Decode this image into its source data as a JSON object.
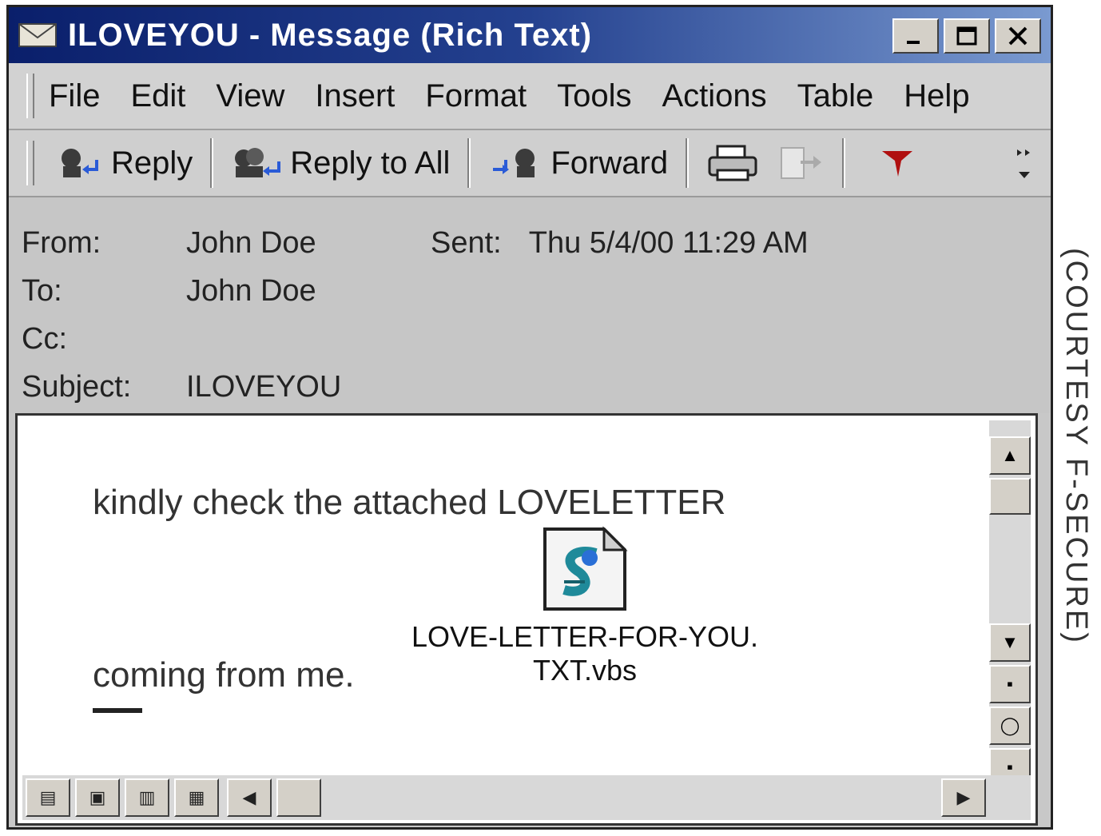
{
  "window": {
    "title": "ILOVEYOU - Message (Rich Text)",
    "title_bar_color": "#0a1f6b"
  },
  "menu": {
    "items": [
      {
        "label": "File"
      },
      {
        "label": "Edit"
      },
      {
        "label": "View"
      },
      {
        "label": "Insert"
      },
      {
        "label": "Format"
      },
      {
        "label": "Tools"
      },
      {
        "label": "Actions"
      },
      {
        "label": "Table"
      },
      {
        "label": "Help"
      }
    ]
  },
  "toolbar": {
    "reply_label": "Reply",
    "reply_all_label": "Reply to All",
    "forward_label": "Forward",
    "icons": [
      "reply-icon",
      "reply-all-icon",
      "forward-icon",
      "print-icon",
      "move-icon",
      "flag-icon",
      "more-icon"
    ]
  },
  "header": {
    "from_label": "From:",
    "from_value": "John Doe",
    "sent_label": "Sent:",
    "sent_value": "Thu 5/4/00 11:29 AM",
    "to_label": "To:",
    "to_value": "John Doe",
    "cc_label": "Cc:",
    "cc_value": "",
    "subject_label": "Subject:",
    "subject_value": "ILOVEYOU"
  },
  "body": {
    "line1": "kindly check the attached LOVELETTER",
    "line2": "coming from me.",
    "attachment_name": "LOVE-LETTER-FOR-YOU.TXT.vbs",
    "attachment_icon": "vbscript-file-icon"
  },
  "credit": "(COURTESY F-SECURE)"
}
